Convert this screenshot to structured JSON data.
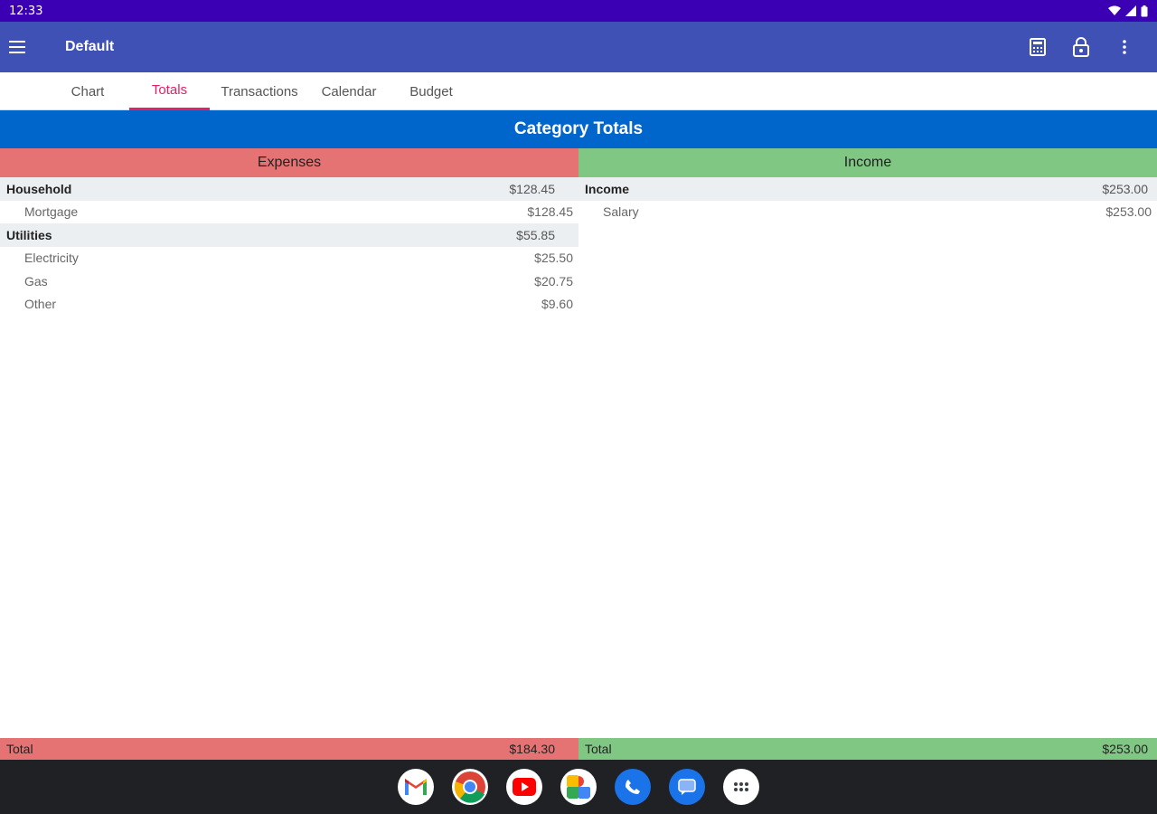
{
  "status_bar": {
    "time": "12:33"
  },
  "app_bar": {
    "title": "Default"
  },
  "tabs": [
    {
      "label": "Chart"
    },
    {
      "label": "Totals"
    },
    {
      "label": "Transactions"
    },
    {
      "label": "Calendar"
    },
    {
      "label": "Budget"
    }
  ],
  "active_tab": "Totals",
  "section_title": "Category Totals",
  "expenses": {
    "header": "Expenses",
    "categories": [
      {
        "name": "Household",
        "amount": "$128.45",
        "items": [
          {
            "name": "Mortgage",
            "amount": "$128.45"
          }
        ]
      },
      {
        "name": "Utilities",
        "amount": "$55.85",
        "items": [
          {
            "name": "Electricity",
            "amount": "$25.50"
          },
          {
            "name": "Gas",
            "amount": "$20.75"
          },
          {
            "name": "Other",
            "amount": "$9.60"
          }
        ]
      }
    ],
    "total_label": "Total",
    "total_amount": "$184.30"
  },
  "income": {
    "header": "Income",
    "categories": [
      {
        "name": "Income",
        "amount": "$253.00",
        "items": [
          {
            "name": "Salary",
            "amount": "$253.00"
          }
        ]
      }
    ],
    "total_label": "Total",
    "total_amount": "$253.00"
  },
  "colors": {
    "status_bar": "#3c00b4",
    "app_bar": "#3f51b5",
    "accent": "#e91e63",
    "section_header": "#0066cc",
    "expenses": "#e57373",
    "income": "#81c784"
  },
  "dock": {
    "apps": [
      {
        "icon": "gmail-icon"
      },
      {
        "icon": "chrome-icon"
      },
      {
        "icon": "youtube-icon"
      },
      {
        "icon": "photos-icon"
      },
      {
        "icon": "phone-icon"
      },
      {
        "icon": "messages-icon"
      },
      {
        "icon": "app-drawer-icon"
      }
    ]
  }
}
